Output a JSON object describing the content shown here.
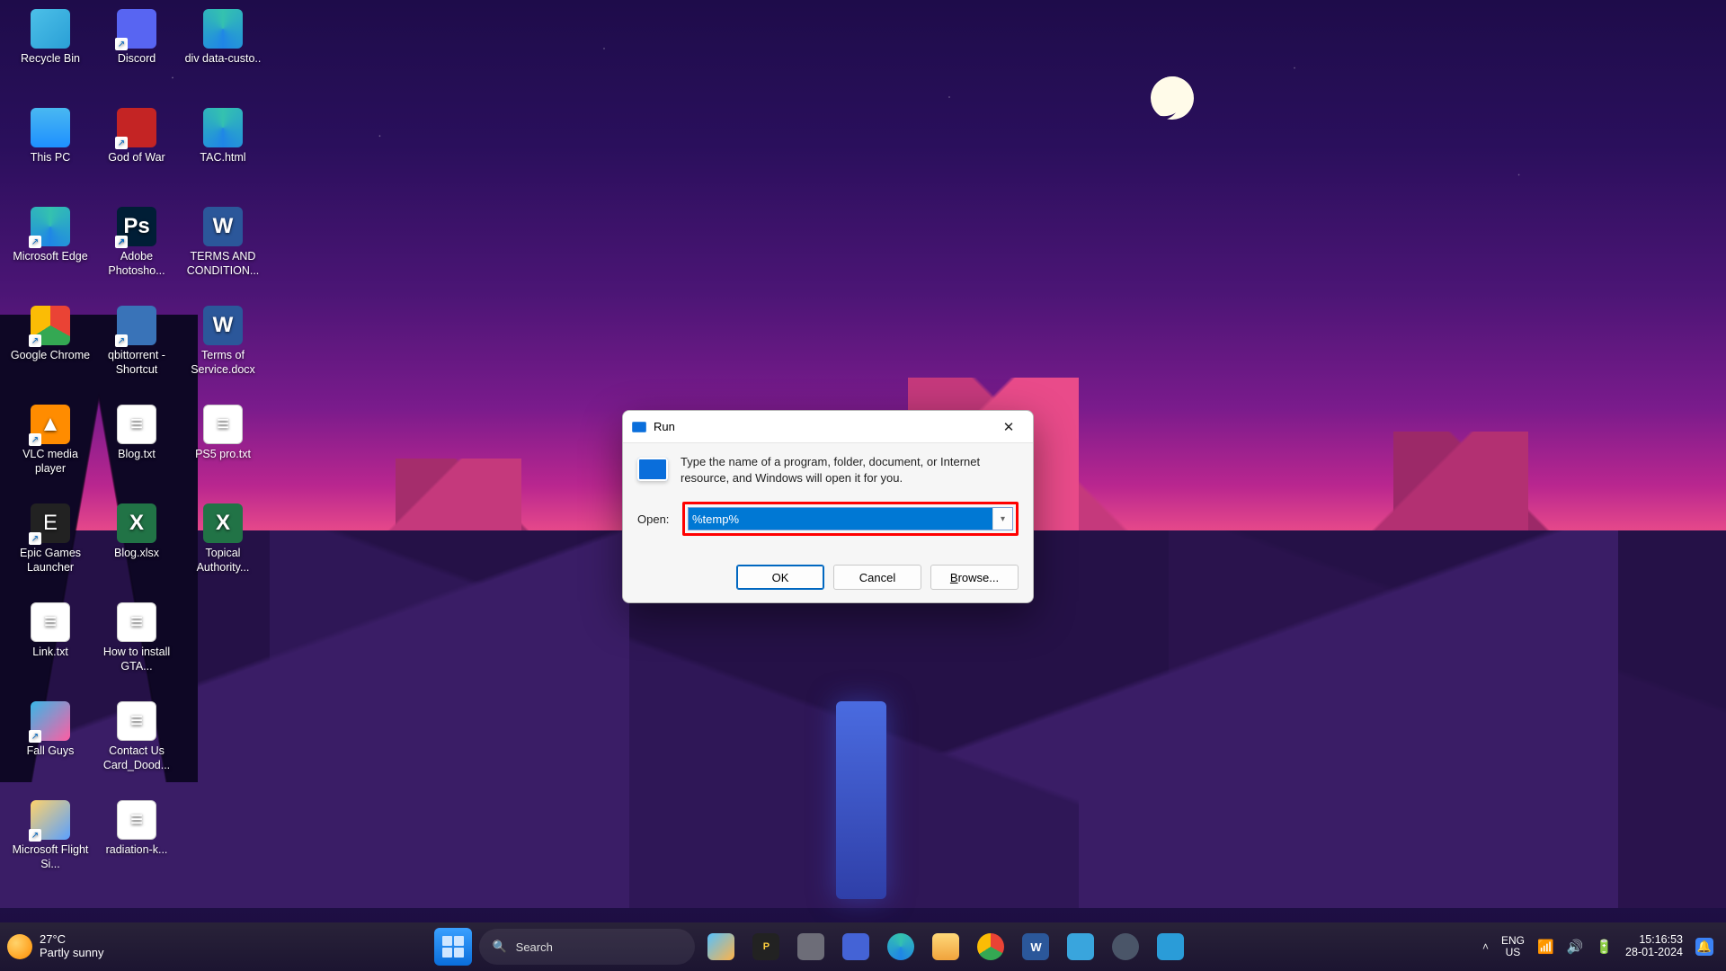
{
  "desktop_icons": [
    {
      "label": "Recycle Bin",
      "cls": "ic-bin"
    },
    {
      "label": "Discord",
      "cls": "ic-discord shortcut"
    },
    {
      "label": "div data-custo..",
      "cls": "ic-edge"
    },
    {
      "label": "This PC",
      "cls": "ic-pc"
    },
    {
      "label": "God of War",
      "cls": "ic-gow shortcut"
    },
    {
      "label": "TAC.html",
      "cls": "ic-edge"
    },
    {
      "label": "Microsoft Edge",
      "cls": "ic-edge shortcut"
    },
    {
      "label": "Adobe Photosho...",
      "cls": "ic-pshop shortcut",
      "glyph": "Ps"
    },
    {
      "label": "TERMS AND CONDITION...",
      "cls": "ic-word",
      "glyph": "W"
    },
    {
      "label": "Google Chrome",
      "cls": "ic-chrome shortcut"
    },
    {
      "label": "qbittorrent - Shortcut",
      "cls": "ic-qbit shortcut"
    },
    {
      "label": "Terms of Service.docx",
      "cls": "ic-word",
      "glyph": "W"
    },
    {
      "label": "VLC media player",
      "cls": "ic-vlc shortcut",
      "glyph": "▲"
    },
    {
      "label": "Blog.txt",
      "cls": "ic-txt",
      "glyph": "≡"
    },
    {
      "label": "PS5 pro.txt",
      "cls": "ic-txt",
      "glyph": "≡"
    },
    {
      "label": "Epic Games Launcher",
      "cls": "ic-epic shortcut",
      "glyph": "E"
    },
    {
      "label": "Blog.xlsx",
      "cls": "ic-excel",
      "glyph": "X"
    },
    {
      "label": "Topical Authority...",
      "cls": "ic-excel",
      "glyph": "X"
    },
    {
      "label": "Link.txt",
      "cls": "ic-txt",
      "glyph": "≡"
    },
    {
      "label": "How to install GTA...",
      "cls": "ic-txt",
      "glyph": "≡"
    },
    {
      "label": "",
      "cls": "ic-blank"
    },
    {
      "label": "Fall Guys",
      "cls": "ic-fall shortcut"
    },
    {
      "label": "Contact Us Card_Dood...",
      "cls": "ic-txt",
      "glyph": "≡"
    },
    {
      "label": "",
      "cls": "ic-blank"
    },
    {
      "label": "Microsoft Flight Si...",
      "cls": "ic-msfs shortcut"
    },
    {
      "label": "radiation-k...",
      "cls": "ic-txt",
      "glyph": "≡"
    }
  ],
  "run": {
    "title": "Run",
    "description": "Type the name of a program, folder, document, or Internet resource, and Windows will open it for you.",
    "open_label": "Open:",
    "open_value": "%temp%",
    "ok": "OK",
    "cancel": "Cancel",
    "browse": "Browse..."
  },
  "taskbar": {
    "weather_temp": "27°C",
    "weather_desc": "Partly sunny",
    "search_placeholder": "Search",
    "lang_top": "ENG",
    "lang_bot": "US",
    "time": "15:16:53",
    "date": "28-01-2024"
  }
}
